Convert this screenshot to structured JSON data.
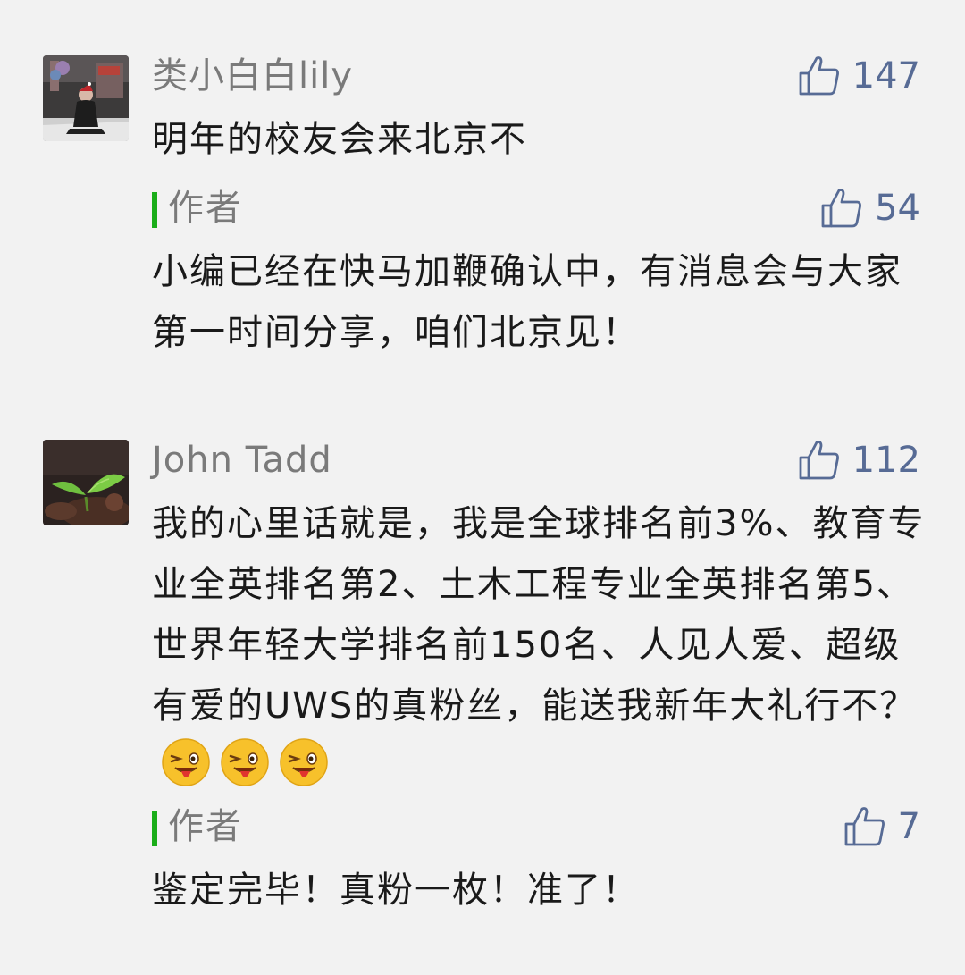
{
  "comments": [
    {
      "user": "类小白白lily",
      "likes": "147",
      "text": "明年的校友会来北京不",
      "avatar": "photo-person-with-santa-hat",
      "reply": {
        "author": "作者",
        "likes": "54",
        "text": "小编已经在快马加鞭确认中，有消息会与大家第一时间分享，咱们北京见！"
      }
    },
    {
      "user": "John Tadd",
      "likes": "112",
      "text": "我的心里话就是，我是全球排名前3%、教育专业全英排名第2、土木工程专业全英排名第5、世界年轻大学排名前150名、人见人爱、超级有爱的UWS的真粉丝，能送我新年大礼行不？",
      "emojis": [
        "tongue-wink-emoji",
        "tongue-wink-emoji",
        "tongue-wink-emoji"
      ],
      "avatar": "photo-green-plant",
      "reply": {
        "author": "作者",
        "likes": "7",
        "text": "鉴定完毕！真粉一枚！准了！"
      }
    }
  ],
  "colors": {
    "background": "#f2f2f2",
    "like_blue": "#576b95",
    "author_bar_green": "#1aad19",
    "name_gray": "#7a7a7a",
    "text": "#1a1a1a"
  },
  "icons": {
    "like": "thumbs-up-outline-icon"
  }
}
